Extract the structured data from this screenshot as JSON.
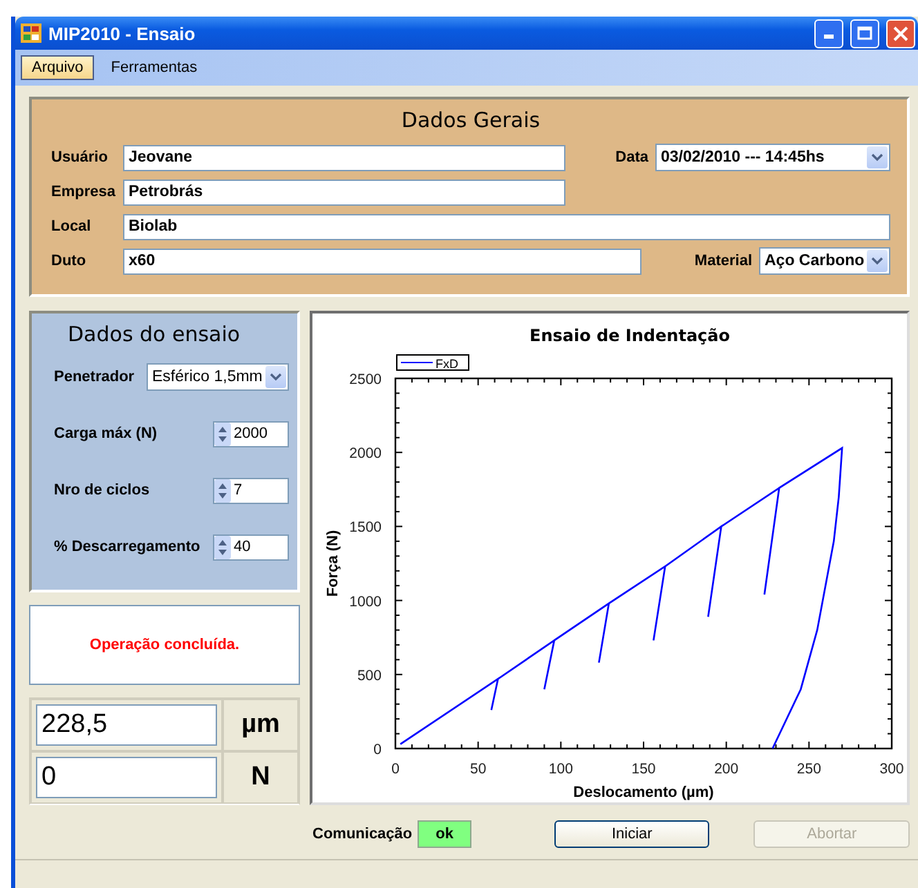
{
  "window": {
    "title": "MIP2010 - Ensaio"
  },
  "menu": [
    {
      "label": "Arquivo",
      "selected": true
    },
    {
      "label": "Ferramentas",
      "selected": false
    }
  ],
  "general": {
    "title": "Dados Gerais",
    "rows": [
      {
        "fields": [
          {
            "kind": "text",
            "label": "Usuário",
            "value": "Jeovane"
          },
          {
            "kind": "dropdown",
            "label": "Data",
            "value": "03/02/2010 --- 14:45hs"
          }
        ]
      },
      {
        "fields": [
          {
            "kind": "text",
            "label": "Empresa",
            "value": "Petrobrás"
          }
        ]
      },
      {
        "fields": [
          {
            "kind": "text",
            "label": "Local",
            "value": "Biolab"
          }
        ]
      },
      {
        "fields": [
          {
            "kind": "text",
            "label": "Duto",
            "value": "x60"
          },
          {
            "kind": "dropdown",
            "label": "Material",
            "value": "Aço Carbono"
          }
        ]
      }
    ]
  },
  "test": {
    "title": "Dados do ensaio",
    "fields": [
      {
        "kind": "dropdown",
        "label": "Penetrador",
        "value": "Esférico 1,5mm"
      },
      {
        "kind": "spinner",
        "label": "Carga máx (N)",
        "value": "2000"
      },
      {
        "kind": "spinner",
        "label": "Nro de ciclos",
        "value": "7"
      },
      {
        "kind": "spinner",
        "label": "% Descarregamento",
        "value": "40"
      }
    ]
  },
  "message": "Operação concluída.",
  "readouts": [
    {
      "value": "228,5",
      "unit": "µm"
    },
    {
      "value": "0",
      "unit": "N"
    }
  ],
  "chart": {
    "chart_data": {
      "type": "line",
      "title": "Ensaio de Indentação",
      "xlabel": "Deslocamento (µm)",
      "ylabel": "Força (N)",
      "x": [
        3,
        62,
        58,
        62,
        96,
        90,
        96,
        129,
        123,
        129,
        163,
        156,
        163,
        197,
        189,
        197,
        232,
        223,
        232,
        270,
        268,
        265,
        255,
        245,
        228
      ],
      "series": [
        {
          "name": "FxD",
          "color": "#0000ff",
          "values": [
            30,
            470,
            260,
            470,
            730,
            400,
            730,
            980,
            580,
            980,
            1230,
            730,
            1230,
            1500,
            890,
            1500,
            1760,
            1040,
            1760,
            2030,
            1700,
            1400,
            800,
            400,
            0
          ]
        }
      ],
      "xlim": [
        0,
        300
      ],
      "ylim": [
        0,
        2500
      ],
      "xticks": [
        0,
        50,
        100,
        150,
        200,
        250,
        300
      ],
      "yticks": [
        0,
        500,
        1000,
        1500,
        2000,
        2500
      ]
    }
  },
  "status": {
    "label": "Comunicação",
    "value": "ok"
  },
  "buttons": [
    {
      "label": "Iniciar",
      "disabled": false
    },
    {
      "label": "Abortar",
      "disabled": true
    }
  ]
}
